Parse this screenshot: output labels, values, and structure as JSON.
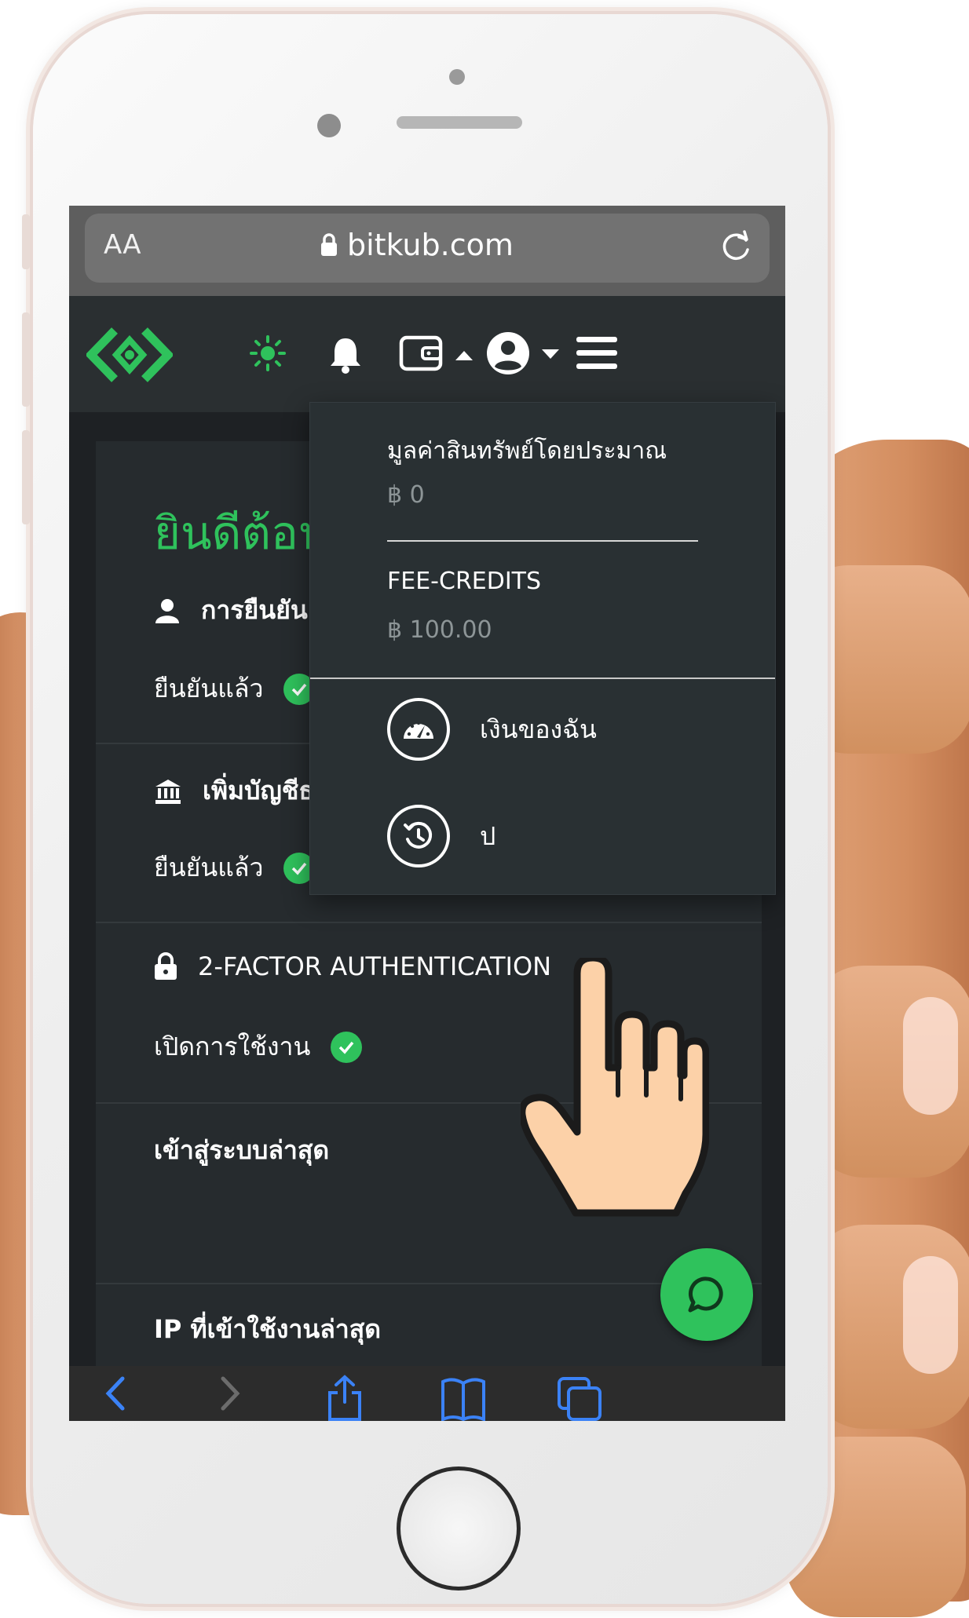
{
  "browser": {
    "text_size_label": "AA",
    "url": "bitkub.com"
  },
  "navbar": {
    "logo_icon": "bitkub-logo-icon",
    "theme_icon": "sun-icon",
    "notification_icon": "bell-icon",
    "wallet_icon": "wallet-icon",
    "account_icon": "user-circle-icon",
    "menu_icon": "hamburger-icon"
  },
  "colors": {
    "accent": "#2fc25c",
    "background": "#262b2e",
    "navbar": "#2a2f31"
  },
  "page": {
    "welcome": "ยินดีต้อน",
    "identity": {
      "title": "การยืนยัน",
      "status": "ยืนยันแล้ว"
    },
    "bank": {
      "title": "เพิ่มบัญชีธ",
      "status": "ยืนยันแล้ว"
    },
    "two_factor": {
      "title": "2-FACTOR AUTHENTICATION",
      "status": "เปิดการใช้งาน"
    },
    "last_login": {
      "title": "เข้าสู่ระบบล่าสุด"
    },
    "last_ip": {
      "title": "IP ที่เข้าใช้งานล่าสุด"
    }
  },
  "wallet_menu": {
    "estimated_value_label": "มูลค่าสินทรัพย์โดยประมาณ",
    "estimated_value": "฿ 0",
    "fee_credits_label": "FEE-CREDITS",
    "fee_credits_value": "฿ 100.00",
    "items": [
      {
        "label": "เงินของฉัน",
        "icon": "speedometer-icon"
      },
      {
        "label": "ป",
        "icon": "history-icon"
      }
    ]
  }
}
